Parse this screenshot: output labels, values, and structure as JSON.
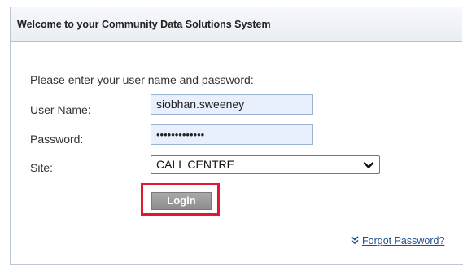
{
  "panel": {
    "title": "Welcome to your Community Data Solutions System"
  },
  "login_form": {
    "instructions": "Please enter your user name and password:",
    "username_label": "User Name:",
    "username_value": "siobhan.sweeney",
    "password_label": "Password:",
    "password_mask": "•••••••••••••",
    "site_label": "Site:",
    "site_selected": "CALL CENTRE",
    "login_label": "Login",
    "forgot_password_label": "Forgot Password?"
  },
  "icons": {
    "dropdown": "chevron-down-icon",
    "forgot": "double-chevron-down-icon"
  },
  "colors": {
    "highlight": "#e0192e",
    "input_fill": "#e8f0fe",
    "link": "#1f4f8f",
    "button": "#9a9a9a"
  }
}
